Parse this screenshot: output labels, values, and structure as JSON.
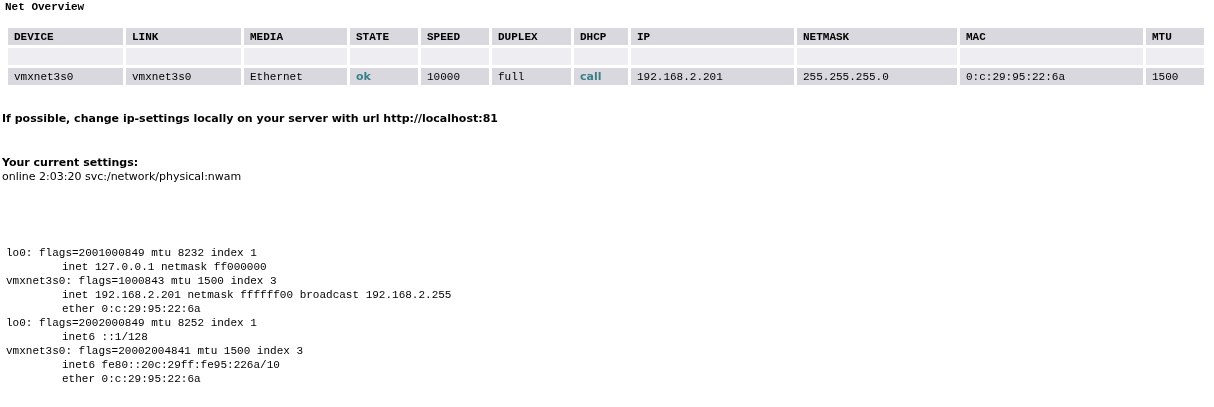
{
  "title": "Net Overview",
  "table": {
    "columns": [
      "DEVICE",
      "LINK",
      "MEDIA",
      "STATE",
      "SPEED",
      "DUPLEX",
      "DHCP",
      "IP",
      "NETMASK",
      "MAC",
      "MTU"
    ],
    "rows": [
      {
        "cells": [
          {
            "text": "vmxnet3s0",
            "kind": "plain"
          },
          {
            "text": "vmxnet3s0",
            "kind": "plain"
          },
          {
            "text": "Ethernet",
            "kind": "plain"
          },
          {
            "text": "ok",
            "kind": "status"
          },
          {
            "text": "10000",
            "kind": "plain"
          },
          {
            "text": "full",
            "kind": "plain"
          },
          {
            "text": "call",
            "kind": "status"
          },
          {
            "text": "192.168.2.201",
            "kind": "plain"
          },
          {
            "text": "255.255.255.0",
            "kind": "plain"
          },
          {
            "text": "0:c:29:95:22:6a",
            "kind": "plain"
          },
          {
            "text": "1500",
            "kind": "plain"
          }
        ]
      }
    ]
  },
  "notice": "If possible, change ip-settings locally on your server with url http://localhost:81",
  "settings_heading": "Your current settings:",
  "service_line": "online 2:03:20 svc:/network/physical:nwam",
  "interfaces": [
    {
      "text": "lo0: flags=2001000849 mtu 8232 index 1",
      "children": [
        {
          "text": "inet 127.0.0.1 netmask ff000000"
        }
      ]
    },
    {
      "text": "vmxnet3s0: flags=1000843 mtu 1500 index 3",
      "children": [
        {
          "text": "inet 192.168.2.201 netmask ffffff00 broadcast 192.168.2.255"
        },
        {
          "text": "ether 0:c:29:95:22:6a"
        }
      ]
    },
    {
      "text": "lo0: flags=2002000849 mtu 8252 index 1",
      "children": [
        {
          "text": "inet6 ::1/128"
        }
      ]
    },
    {
      "text": "vmxnet3s0: flags=20002004841 mtu 1500 index 3",
      "children": [
        {
          "text": "inet6 fe80::20c:29ff:fe95:226a/10"
        },
        {
          "text": "ether 0:c:29:95:22:6a"
        }
      ]
    }
  ]
}
